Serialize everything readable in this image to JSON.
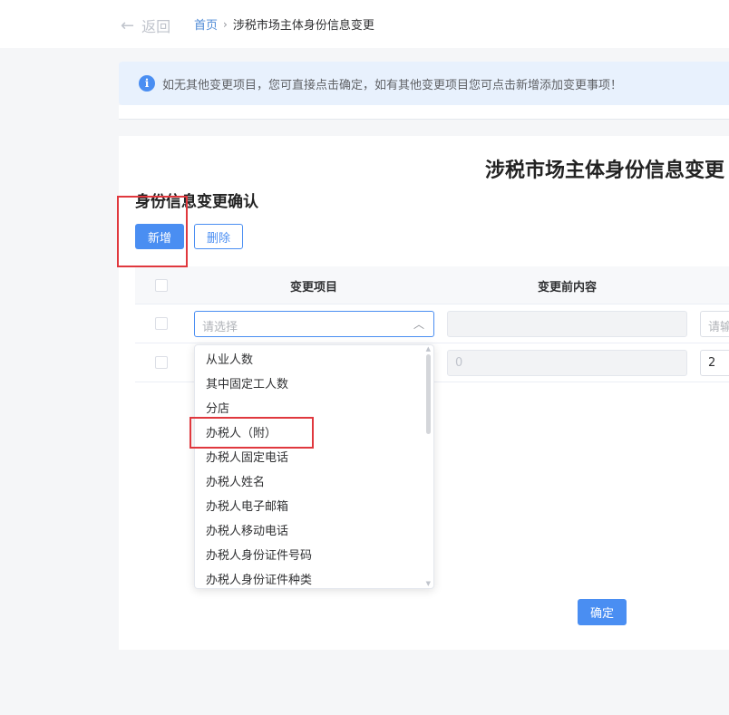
{
  "header": {
    "back_label": "返回",
    "breadcrumb": {
      "home": "首页",
      "separator": "›",
      "current": "涉税市场主体身份信息变更"
    }
  },
  "notice": {
    "icon": "info-icon",
    "text": "如无其他变更项目，您可直接点击确定，如有其他变更项目您可点击新增添加变更事项！"
  },
  "form": {
    "title": "涉税市场主体身份信息变更",
    "section_title": "身份信息变更确认",
    "add_label": "新增",
    "delete_label": "删除",
    "confirm_label": "确定"
  },
  "table": {
    "columns": [
      "变更项目",
      "变更前内容"
    ],
    "rows": [
      {
        "item_placeholder": "请选择",
        "before": "",
        "after": "请输"
      },
      {
        "item_placeholder": "",
        "before": "0",
        "after": "2"
      }
    ]
  },
  "dropdown": {
    "options": [
      "从业人数",
      "其中固定工人数",
      "分店",
      "办税人（附）",
      "办税人固定电话",
      "办税人姓名",
      "办税人电子邮箱",
      "办税人移动电话",
      "办税人身份证件号码",
      "办税人身份证件种类"
    ],
    "highlighted_index": 3
  },
  "colors": {
    "primary": "#4a8ef2",
    "annotation_red": "#e0383e",
    "notice_bg": "#e8f1fd"
  }
}
